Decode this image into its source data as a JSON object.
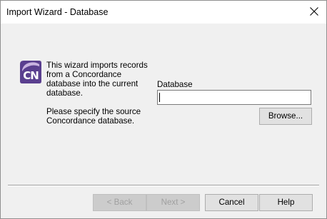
{
  "window": {
    "title": "Import Wizard - Database",
    "close_label": "×"
  },
  "logo": {
    "text": "CN",
    "colors": {
      "background": "#5a3f8f",
      "accent": "#c9b3e0"
    }
  },
  "content": {
    "intro": "This wizard imports records from a Concordance database into the current database.",
    "instruction": "Please specify the source Concordance database.",
    "database_label": "Database",
    "database_value": ""
  },
  "buttons": {
    "browse": "Browse...",
    "back": "< Back",
    "next": "Next >",
    "cancel": "Cancel",
    "help": "Help"
  },
  "colors": {
    "dialog_bg": "#f0f0f0",
    "titlebar_bg": "#ffffff",
    "button_bg": "#e1e1e1",
    "disabled_text": "#a0a0a0"
  }
}
